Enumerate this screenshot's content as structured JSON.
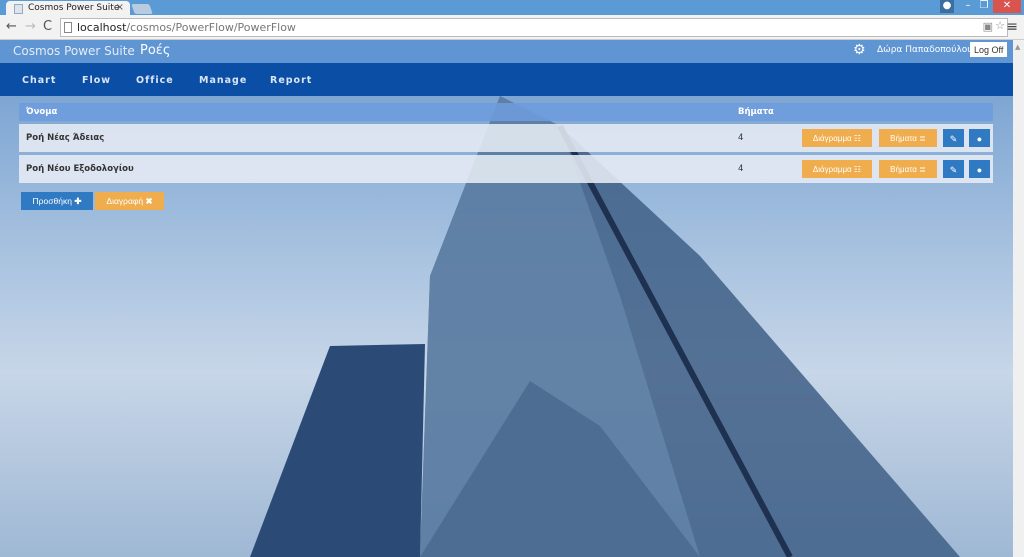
{
  "browser": {
    "tab_title": "Cosmos Power Suite",
    "url_host": "localhost",
    "url_path": "/cosmos/PowerFlow/PowerFlow"
  },
  "header": {
    "brand": "Cosmos Power Suite",
    "page_title": "Ροές",
    "user": "Δώρα Παπαδοπούλου",
    "logoff": "Log Off"
  },
  "nav": [
    "Chart",
    "Flow",
    "Office",
    "Manage",
    "Report"
  ],
  "table": {
    "columns": [
      "Όνομα",
      "Βήματα"
    ],
    "rows": [
      {
        "name": "Ροή Νέας Άδειας",
        "steps": "4"
      },
      {
        "name": "Ροή Νέου Εξοδολογίου",
        "steps": "4"
      }
    ],
    "diagram_label": "Διάγραμμα",
    "steps_label": "Βήματα"
  },
  "actions": {
    "add": "Προσθήκη",
    "delete": "Διαγραφή"
  },
  "colors": {
    "header": "#5f95d3",
    "nav": "#0b4ea6",
    "orange": "#f0ad4e",
    "blue": "#2f7ac3"
  }
}
